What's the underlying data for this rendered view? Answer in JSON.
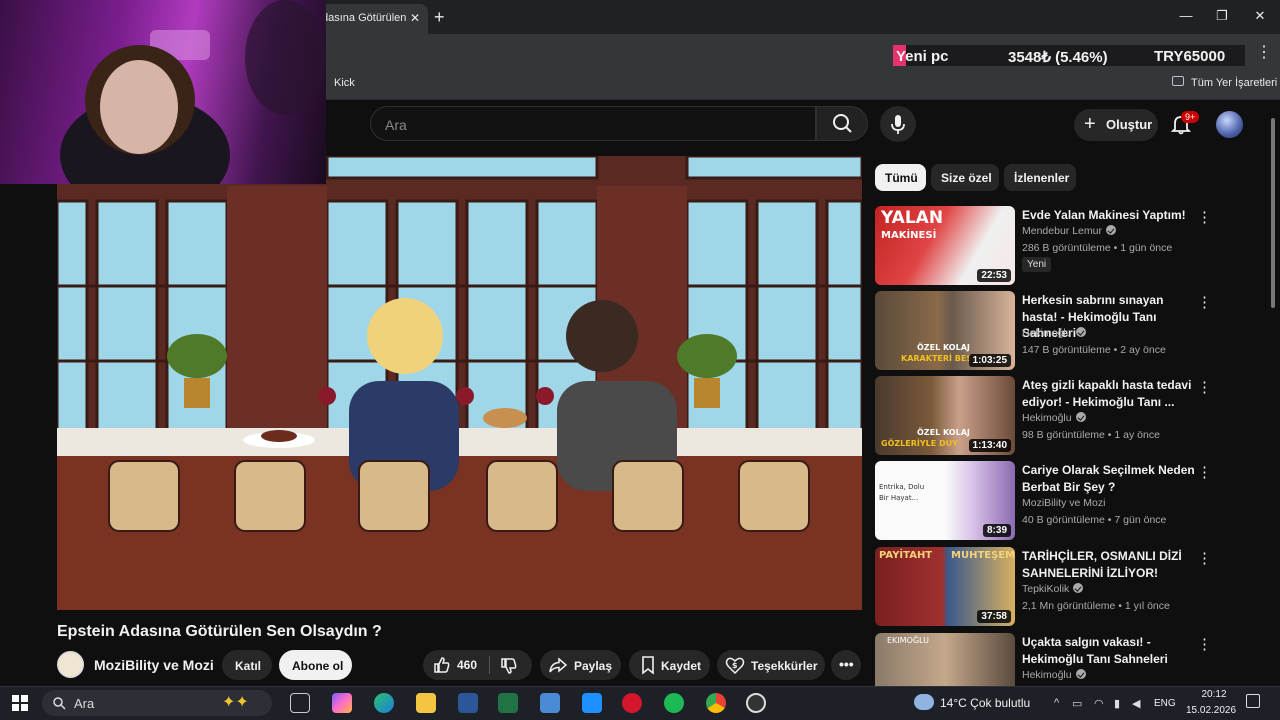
{
  "browser": {
    "tab_title": "dasına Götürülen",
    "bookmark_kick": "Kick",
    "bookmarks_all": "Tüm Yer İşaretleri"
  },
  "ticker": {
    "label": "Yeni pc",
    "amount": "3548₺ (5.46%)",
    "goal": "TRY65000"
  },
  "header": {
    "search_placeholder": "Ara",
    "create_label": "Oluştur",
    "notifications_badge": "9+"
  },
  "video": {
    "title": "Epstein Adasına Götürülen Sen Olsaydın ?",
    "channel": "MoziBility ve Mozi",
    "join_label": "Katıl",
    "subscribe_label": "Abone ol",
    "like_count": "460",
    "share_label": "Paylaş",
    "save_label": "Kaydet",
    "thanks_label": "Teşekkürler"
  },
  "chips": [
    "Tümü",
    "Size özel",
    "İzlenenler"
  ],
  "recommendations": [
    {
      "title": "Evde Yalan Makinesi Yaptım!",
      "channel": "Mendebur Lemur",
      "views": "286 B görüntüleme",
      "age": "1 gün önce",
      "duration": "22:53",
      "badge": "Yeni",
      "thumb_text": "YALAN",
      "thumb_text2": "MAKİNESİ"
    },
    {
      "title": "Herkesin sabrını sınayan hasta! - Hekimoğlu Tanı Sahneleri",
      "channel": "Hekimoğlu",
      "views": "147 B görüntüleme",
      "age": "2 ay önce",
      "duration": "1:03:25",
      "thumb_text": "ÖZEL KOLAJ",
      "thumb_text2": "KARAKTERİ BES"
    },
    {
      "title": "Ateş gizli kapaklı hasta tedavi ediyor! - Hekimoğlu Tanı ...",
      "channel": "Hekimoğlu",
      "views": "98 B görüntüleme",
      "age": "1 ay önce",
      "duration": "1:13:40",
      "thumb_text": "ÖZEL KOLAJ",
      "thumb_text2": "GÖZLERİYLE DUY"
    },
    {
      "title": "Cariye Olarak Seçilmek Neden Berbat Bir Şey ?",
      "channel": "MoziBility ve Mozi",
      "views": "40 B görüntüleme",
      "age": "7 gün önce",
      "duration": "8:39",
      "thumb_text": "Entrika, Dolu",
      "thumb_text2": "Bir Hayat..."
    },
    {
      "title": "TARİHÇİLER, OSMANLI DİZİ SAHNELERİNİ İZLİYOR!",
      "channel": "TepkiKolik",
      "views": "2,1 Mn görüntüleme",
      "age": "1 yıl önce",
      "duration": "37:58",
      "thumb_text": "PAYİTAHT",
      "thumb_text2": "MUHTEŞEM"
    },
    {
      "title": "Uçakta salgın vakası! - Hekimoğlu Tanı Sahneleri",
      "channel": "Hekimoğlu",
      "views": "",
      "age": "",
      "duration": "",
      "thumb_text": "EKIMOĞLU",
      "thumb_text2": ""
    }
  ],
  "taskbar": {
    "search_placeholder": "Ara",
    "weather": "14°C  Çok bulutlu",
    "language": "ENG",
    "time": "20:12",
    "date": "15.02.2026"
  },
  "icons": {
    "search": "search-icon",
    "mic": "mic-icon",
    "create": "plus-icon",
    "bell": "bell-icon",
    "like": "thumbs-up-icon",
    "dislike": "thumbs-down-icon",
    "share": "share-icon",
    "save": "bookmark-icon",
    "thanks": "dollar-heart-icon",
    "more": "more-horizontal-icon"
  },
  "colors": {
    "background": "#0f0f0f",
    "accent_red": "#cc0000",
    "ticker_pink": "#e7306e"
  }
}
